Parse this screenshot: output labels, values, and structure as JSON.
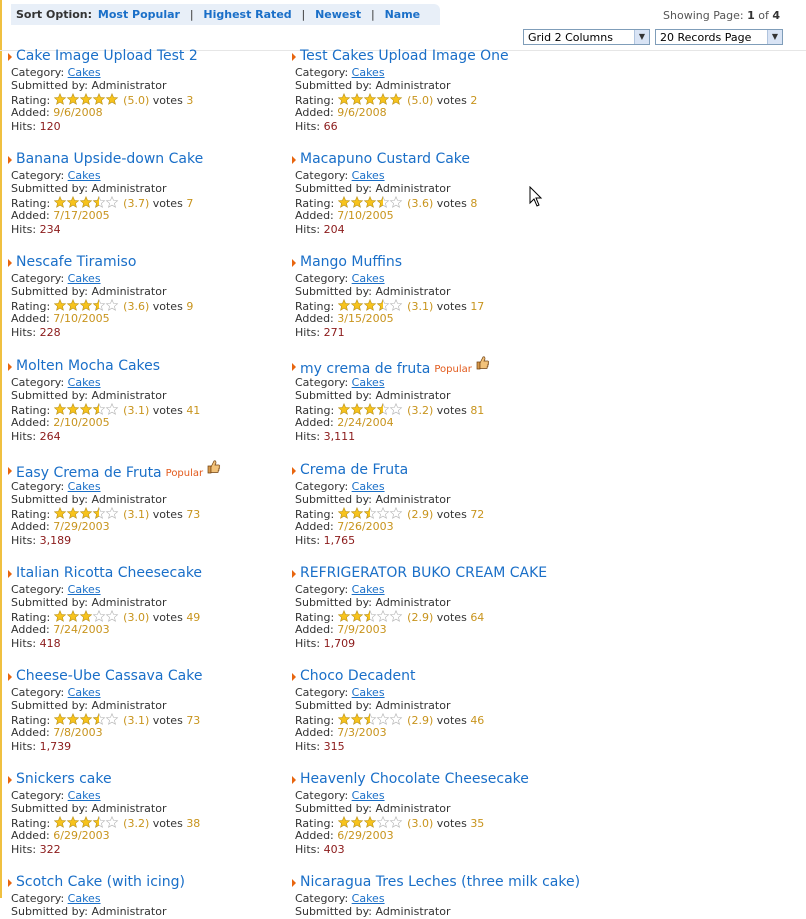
{
  "sort": {
    "label": "Sort Option:",
    "options": [
      "Most Popular",
      "Highest Rated",
      "Newest",
      "Name"
    ],
    "separator": "|"
  },
  "paging": {
    "prefix": "Showing Page:",
    "current": "1",
    "of": "of",
    "total": "4",
    "layout_select": "Grid 2 Columns",
    "records_select": "20 Records Page"
  },
  "labels": {
    "category": "Category:",
    "submitted": "Submitted by:",
    "rating": "Rating:",
    "votes": "votes",
    "added": "Added:",
    "hits": "Hits:"
  },
  "colors": {
    "link": "#1a6fc8",
    "accent": "#e8650f",
    "rating": "#c8941d",
    "hits": "#8b1a1a",
    "popular": "#e25a1c"
  },
  "recipes": [
    {
      "title": "Cake Image Upload Test 2",
      "category": "Cakes",
      "submitter": "Administrator",
      "rating": "(5.0)",
      "stars": 5.0,
      "votes": "3",
      "added": "9/6/2008",
      "hits": "120",
      "popular": ""
    },
    {
      "title": "Test Cakes Upload Image One",
      "category": "Cakes",
      "submitter": "Administrator",
      "rating": "(5.0)",
      "stars": 5.0,
      "votes": "2",
      "added": "9/6/2008",
      "hits": "66",
      "popular": ""
    },
    {
      "title": "Banana Upside-down Cake",
      "category": "Cakes",
      "submitter": "Administrator",
      "rating": "(3.7)",
      "stars": 3.5,
      "votes": "7",
      "added": "7/17/2005",
      "hits": "234",
      "popular": ""
    },
    {
      "title": "Macapuno Custard Cake",
      "category": "Cakes",
      "submitter": "Administrator",
      "rating": "(3.6)",
      "stars": 3.5,
      "votes": "8",
      "added": "7/10/2005",
      "hits": "204",
      "popular": ""
    },
    {
      "title": "Nescafe Tiramiso",
      "category": "Cakes",
      "submitter": "Administrator",
      "rating": "(3.6)",
      "stars": 3.5,
      "votes": "9",
      "added": "7/10/2005",
      "hits": "228",
      "popular": ""
    },
    {
      "title": "Mango Muffins",
      "category": "Cakes",
      "submitter": "Administrator",
      "rating": "(3.1)",
      "stars": 3.5,
      "votes": "17",
      "added": "3/15/2005",
      "hits": "271",
      "popular": ""
    },
    {
      "title": "Molten Mocha Cakes",
      "category": "Cakes",
      "submitter": "Administrator",
      "rating": "(3.1)",
      "stars": 3.5,
      "votes": "41",
      "added": "2/10/2005",
      "hits": "264",
      "popular": ""
    },
    {
      "title": "my crema de fruta",
      "category": "Cakes",
      "submitter": "Administrator",
      "rating": "(3.2)",
      "stars": 3.5,
      "votes": "81",
      "added": "2/24/2004",
      "hits": "3,111",
      "popular": "Popular"
    },
    {
      "title": "Easy Crema de Fruta",
      "category": "Cakes",
      "submitter": "Administrator",
      "rating": "(3.1)",
      "stars": 3.5,
      "votes": "73",
      "added": "7/29/2003",
      "hits": "3,189",
      "popular": "Popular"
    },
    {
      "title": "Crema de Fruta",
      "category": "Cakes",
      "submitter": "Administrator",
      "rating": "(2.9)",
      "stars": 2.5,
      "votes": "72",
      "added": "7/26/2003",
      "hits": "1,765",
      "popular": ""
    },
    {
      "title": "Italian Ricotta Cheesecake",
      "category": "Cakes",
      "submitter": "Administrator",
      "rating": "(3.0)",
      "stars": 3.0,
      "votes": "49",
      "added": "7/24/2003",
      "hits": "418",
      "popular": ""
    },
    {
      "title": "REFRIGERATOR BUKO CREAM CAKE",
      "category": "Cakes",
      "submitter": "Administrator",
      "rating": "(2.9)",
      "stars": 2.5,
      "votes": "64",
      "added": "7/9/2003",
      "hits": "1,709",
      "popular": ""
    },
    {
      "title": "Cheese-Ube Cassava Cake",
      "category": "Cakes",
      "submitter": "Administrator",
      "rating": "(3.1)",
      "stars": 3.5,
      "votes": "73",
      "added": "7/8/2003",
      "hits": "1,739",
      "popular": ""
    },
    {
      "title": "Choco Decadent",
      "category": "Cakes",
      "submitter": "Administrator",
      "rating": "(2.9)",
      "stars": 2.5,
      "votes": "46",
      "added": "7/3/2003",
      "hits": "315",
      "popular": ""
    },
    {
      "title": "Snickers cake",
      "category": "Cakes",
      "submitter": "Administrator",
      "rating": "(3.2)",
      "stars": 3.5,
      "votes": "38",
      "added": "6/29/2003",
      "hits": "322",
      "popular": ""
    },
    {
      "title": "Heavenly Chocolate Cheesecake",
      "category": "Cakes",
      "submitter": "Administrator",
      "rating": "(3.0)",
      "stars": 3.0,
      "votes": "35",
      "added": "6/29/2003",
      "hits": "403",
      "popular": ""
    },
    {
      "title": "Scotch Cake (with icing)",
      "category": "Cakes",
      "submitter": "Administrator",
      "rating": "",
      "stars": 0,
      "votes": "",
      "added": "",
      "hits": "",
      "popular": ""
    },
    {
      "title": "Nicaragua Tres Leches (three milk cake)",
      "category": "Cakes",
      "submitter": "Administrator",
      "rating": "",
      "stars": 0,
      "votes": "",
      "added": "",
      "hits": "",
      "popular": ""
    }
  ]
}
